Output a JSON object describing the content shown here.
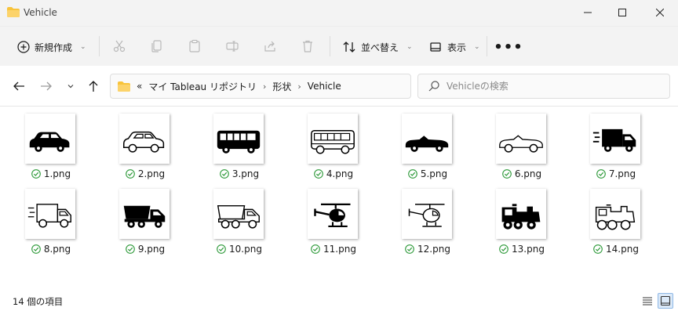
{
  "window": {
    "title": "Vehicle"
  },
  "toolbar": {
    "new_label": "新規作成",
    "sort_label": "並べ替え",
    "view_label": "表示",
    "more_label": "•••"
  },
  "address": {
    "overflow": "«",
    "crumbs": [
      "マイ Tableau リポジトリ",
      "形状",
      "Vehicle"
    ],
    "separator": "›"
  },
  "search": {
    "placeholder": "Vehicleの検索",
    "value": ""
  },
  "files": [
    {
      "name": "1.png",
      "icon": "car-sedan-filled-icon"
    },
    {
      "name": "2.png",
      "icon": "car-sedan-outline-icon"
    },
    {
      "name": "3.png",
      "icon": "bus-filled-icon"
    },
    {
      "name": "4.png",
      "icon": "bus-outline-icon"
    },
    {
      "name": "5.png",
      "icon": "convertible-filled-icon"
    },
    {
      "name": "6.png",
      "icon": "convertible-outline-icon"
    },
    {
      "name": "7.png",
      "icon": "delivery-truck-filled-icon"
    },
    {
      "name": "8.png",
      "icon": "delivery-truck-outline-icon"
    },
    {
      "name": "9.png",
      "icon": "dump-truck-filled-icon"
    },
    {
      "name": "10.png",
      "icon": "dump-truck-outline-icon"
    },
    {
      "name": "11.png",
      "icon": "helicopter-filled-icon"
    },
    {
      "name": "12.png",
      "icon": "helicopter-outline-icon"
    },
    {
      "name": "13.png",
      "icon": "locomotive-filled-icon"
    },
    {
      "name": "14.png",
      "icon": "locomotive-outline-icon"
    }
  ],
  "status": {
    "item_count": "14 個の項目"
  },
  "colors": {
    "accent": "#0067c0",
    "folder": "#f8c33a",
    "sync_ok": "#2e9a3a"
  }
}
